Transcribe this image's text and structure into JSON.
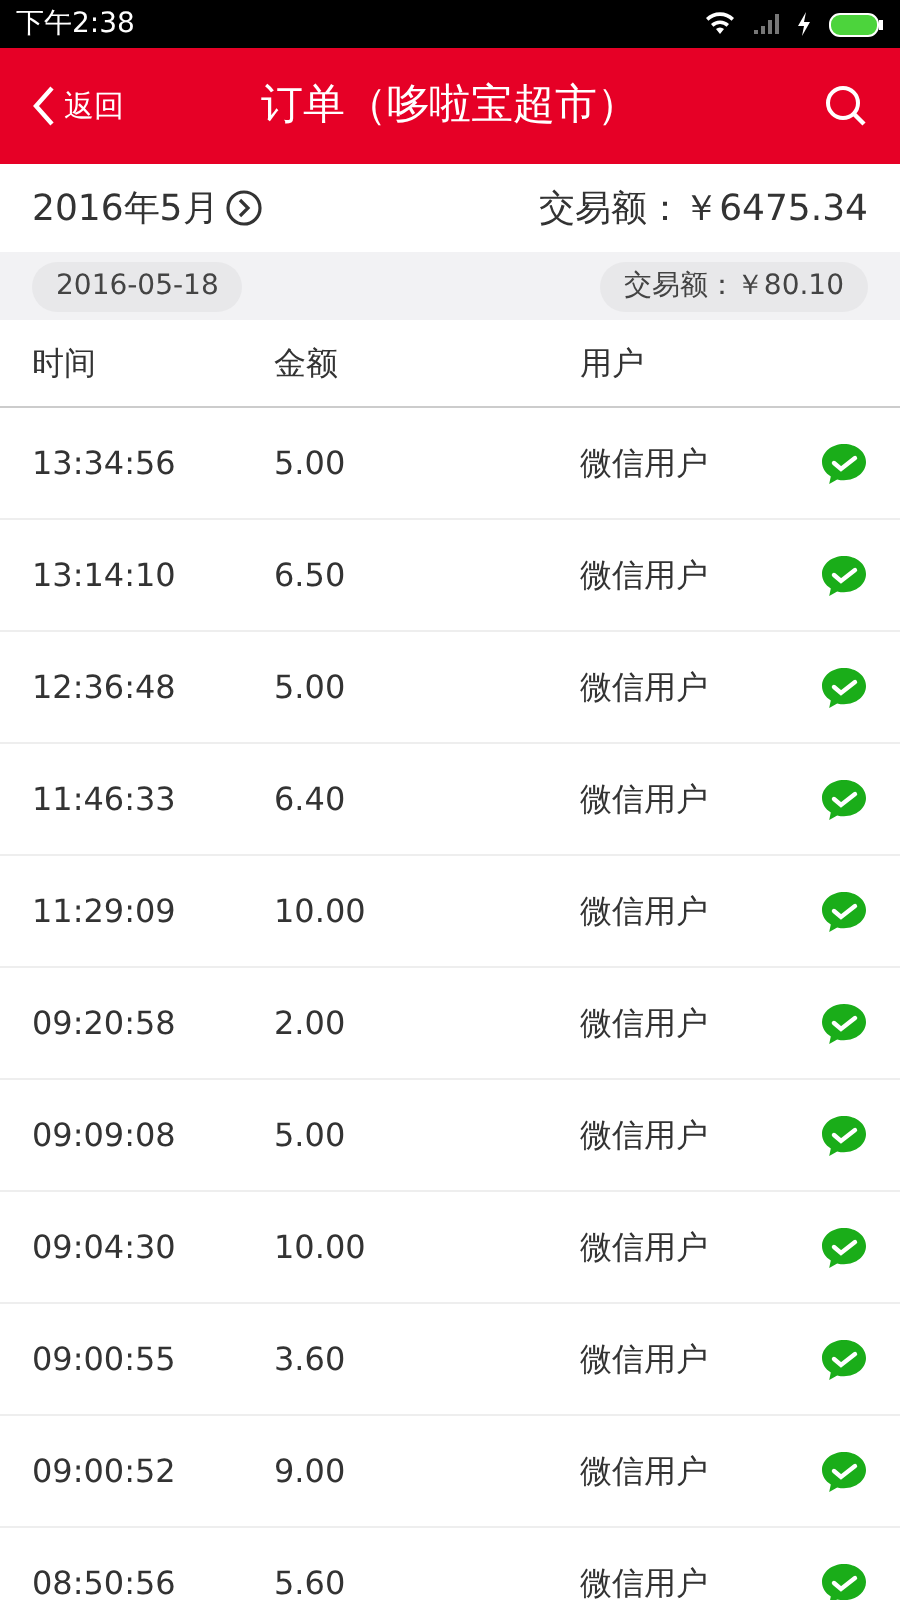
{
  "status_bar": {
    "time": "下午2:38"
  },
  "header": {
    "back": "返回",
    "title": "订单（哆啦宝超市）"
  },
  "summary": {
    "month": "2016年5月",
    "total": "交易额：￥6475.34"
  },
  "day": {
    "date": "2016-05-18",
    "total": "交易额：￥80.10"
  },
  "table": {
    "columns": [
      "时间",
      "金额",
      "用户"
    ],
    "rows": [
      {
        "time": "13:34:56",
        "amount": "5.00",
        "user": "微信用户"
      },
      {
        "time": "13:14:10",
        "amount": "6.50",
        "user": "微信用户"
      },
      {
        "time": "12:36:48",
        "amount": "5.00",
        "user": "微信用户"
      },
      {
        "time": "11:46:33",
        "amount": "6.40",
        "user": "微信用户"
      },
      {
        "time": "11:29:09",
        "amount": "10.00",
        "user": "微信用户"
      },
      {
        "time": "09:20:58",
        "amount": "2.00",
        "user": "微信用户"
      },
      {
        "time": "09:09:08",
        "amount": "5.00",
        "user": "微信用户"
      },
      {
        "time": "09:04:30",
        "amount": "10.00",
        "user": "微信用户"
      },
      {
        "time": "09:00:55",
        "amount": "3.60",
        "user": "微信用户"
      },
      {
        "time": "09:00:52",
        "amount": "9.00",
        "user": "微信用户"
      },
      {
        "time": "08:50:56",
        "amount": "5.60",
        "user": "微信用户"
      }
    ]
  }
}
